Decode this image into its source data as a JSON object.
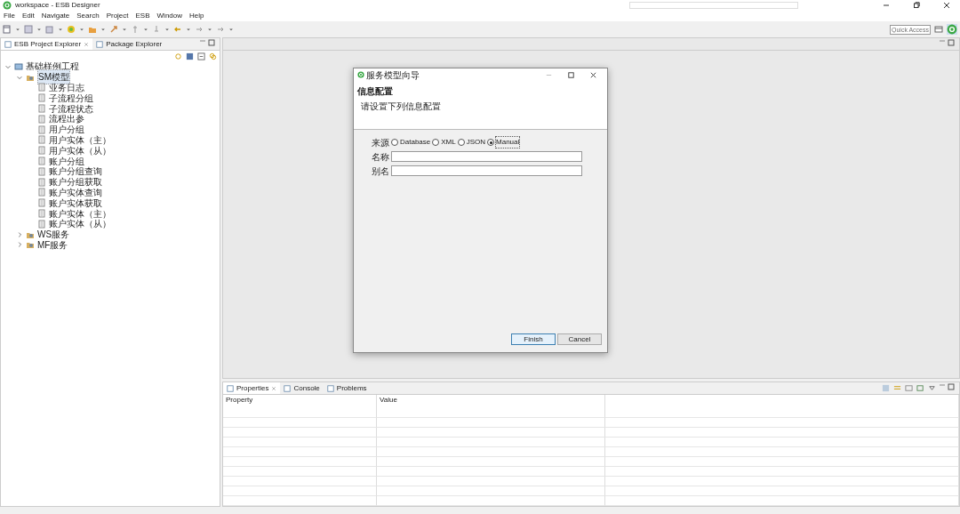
{
  "window": {
    "title": "workspace - ESB Designer"
  },
  "menu": [
    "File",
    "Edit",
    "Navigate",
    "Search",
    "Project",
    "ESB",
    "Window",
    "Help"
  ],
  "quick_access": {
    "placeholder": "Quick Access"
  },
  "left_tabs": [
    {
      "label": "ESB Project Explorer",
      "selected": true,
      "closable": true
    },
    {
      "label": "Package Explorer",
      "selected": false,
      "closable": false
    }
  ],
  "tree": [
    {
      "label": "基础样例工程",
      "kind": "project",
      "expanded": true,
      "children": [
        {
          "label": "SM模型",
          "kind": "folder",
          "expanded": true,
          "selected": true,
          "children": [
            {
              "label": "业务日志",
              "kind": "file"
            },
            {
              "label": "子流程分组",
              "kind": "file"
            },
            {
              "label": "子流程状态",
              "kind": "file"
            },
            {
              "label": "流程出参",
              "kind": "file"
            },
            {
              "label": "用户分组",
              "kind": "file"
            },
            {
              "label": "用户实体（主）",
              "kind": "file"
            },
            {
              "label": "用户实体（从）",
              "kind": "file"
            },
            {
              "label": "账户分组",
              "kind": "file"
            },
            {
              "label": "账户分组查询",
              "kind": "file"
            },
            {
              "label": "账户分组获取",
              "kind": "file"
            },
            {
              "label": "账户实体查询",
              "kind": "file"
            },
            {
              "label": "账户实体获取",
              "kind": "file"
            },
            {
              "label": "账户实体（主）",
              "kind": "file"
            },
            {
              "label": "账户实体（从）",
              "kind": "file"
            }
          ]
        },
        {
          "label": "WS服务",
          "kind": "folder",
          "expanded": false,
          "selected": false
        },
        {
          "label": "MF服务",
          "kind": "folder",
          "expanded": false,
          "selected": false
        }
      ]
    }
  ],
  "dialog": {
    "title": "服务模型向导",
    "heading": "信息配置",
    "description": "请设置下列信息配置",
    "source_label": "来源",
    "sources": [
      {
        "label": "Database",
        "selected": false
      },
      {
        "label": "XML",
        "selected": false
      },
      {
        "label": "JSON",
        "selected": false
      },
      {
        "label": "Manual",
        "selected": true
      }
    ],
    "fields": [
      {
        "label": "名称"
      },
      {
        "label": "别名"
      }
    ],
    "buttons": [
      {
        "label": "Finish",
        "default": true
      },
      {
        "label": "Cancel",
        "default": false
      }
    ]
  },
  "bottom_tabs": [
    {
      "label": "Properties",
      "selected": true,
      "closable": true
    },
    {
      "label": "Console",
      "selected": false,
      "closable": false
    },
    {
      "label": "Problems",
      "selected": false,
      "closable": false
    }
  ],
  "properties_table": {
    "columns": [
      "Property",
      "Value"
    ]
  }
}
